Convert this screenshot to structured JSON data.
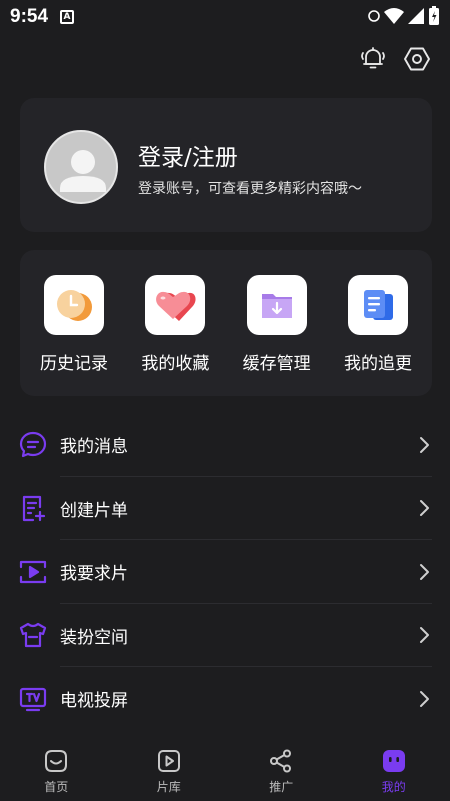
{
  "status": {
    "time": "9:54",
    "app_badge": "A"
  },
  "profile": {
    "title": "登录/注册",
    "subtitle": "登录账号，可查看更多精彩内容哦～"
  },
  "quick": [
    {
      "label": "历史记录",
      "icon": "history-clock-icon"
    },
    {
      "label": "我的收藏",
      "icon": "heart-icon"
    },
    {
      "label": "缓存管理",
      "icon": "download-folder-icon"
    },
    {
      "label": "我的追更",
      "icon": "document-copy-icon"
    }
  ],
  "menu": [
    {
      "label": "我的消息",
      "icon": "message-icon"
    },
    {
      "label": "创建片单",
      "icon": "create-list-icon"
    },
    {
      "label": "我要求片",
      "icon": "play-request-icon"
    },
    {
      "label": "装扮空间",
      "icon": "tshirt-icon"
    },
    {
      "label": "电视投屏",
      "icon": "tv-cast-icon"
    }
  ],
  "tabs": [
    {
      "label": "首页",
      "icon": "home-face-icon"
    },
    {
      "label": "片库",
      "icon": "play-library-icon"
    },
    {
      "label": "推广",
      "icon": "share-icon"
    },
    {
      "label": "我的",
      "icon": "mine-face-icon"
    }
  ],
  "colors": {
    "accent": "#7a3cf0",
    "background": "#1d1d1f",
    "card": "#242428"
  }
}
